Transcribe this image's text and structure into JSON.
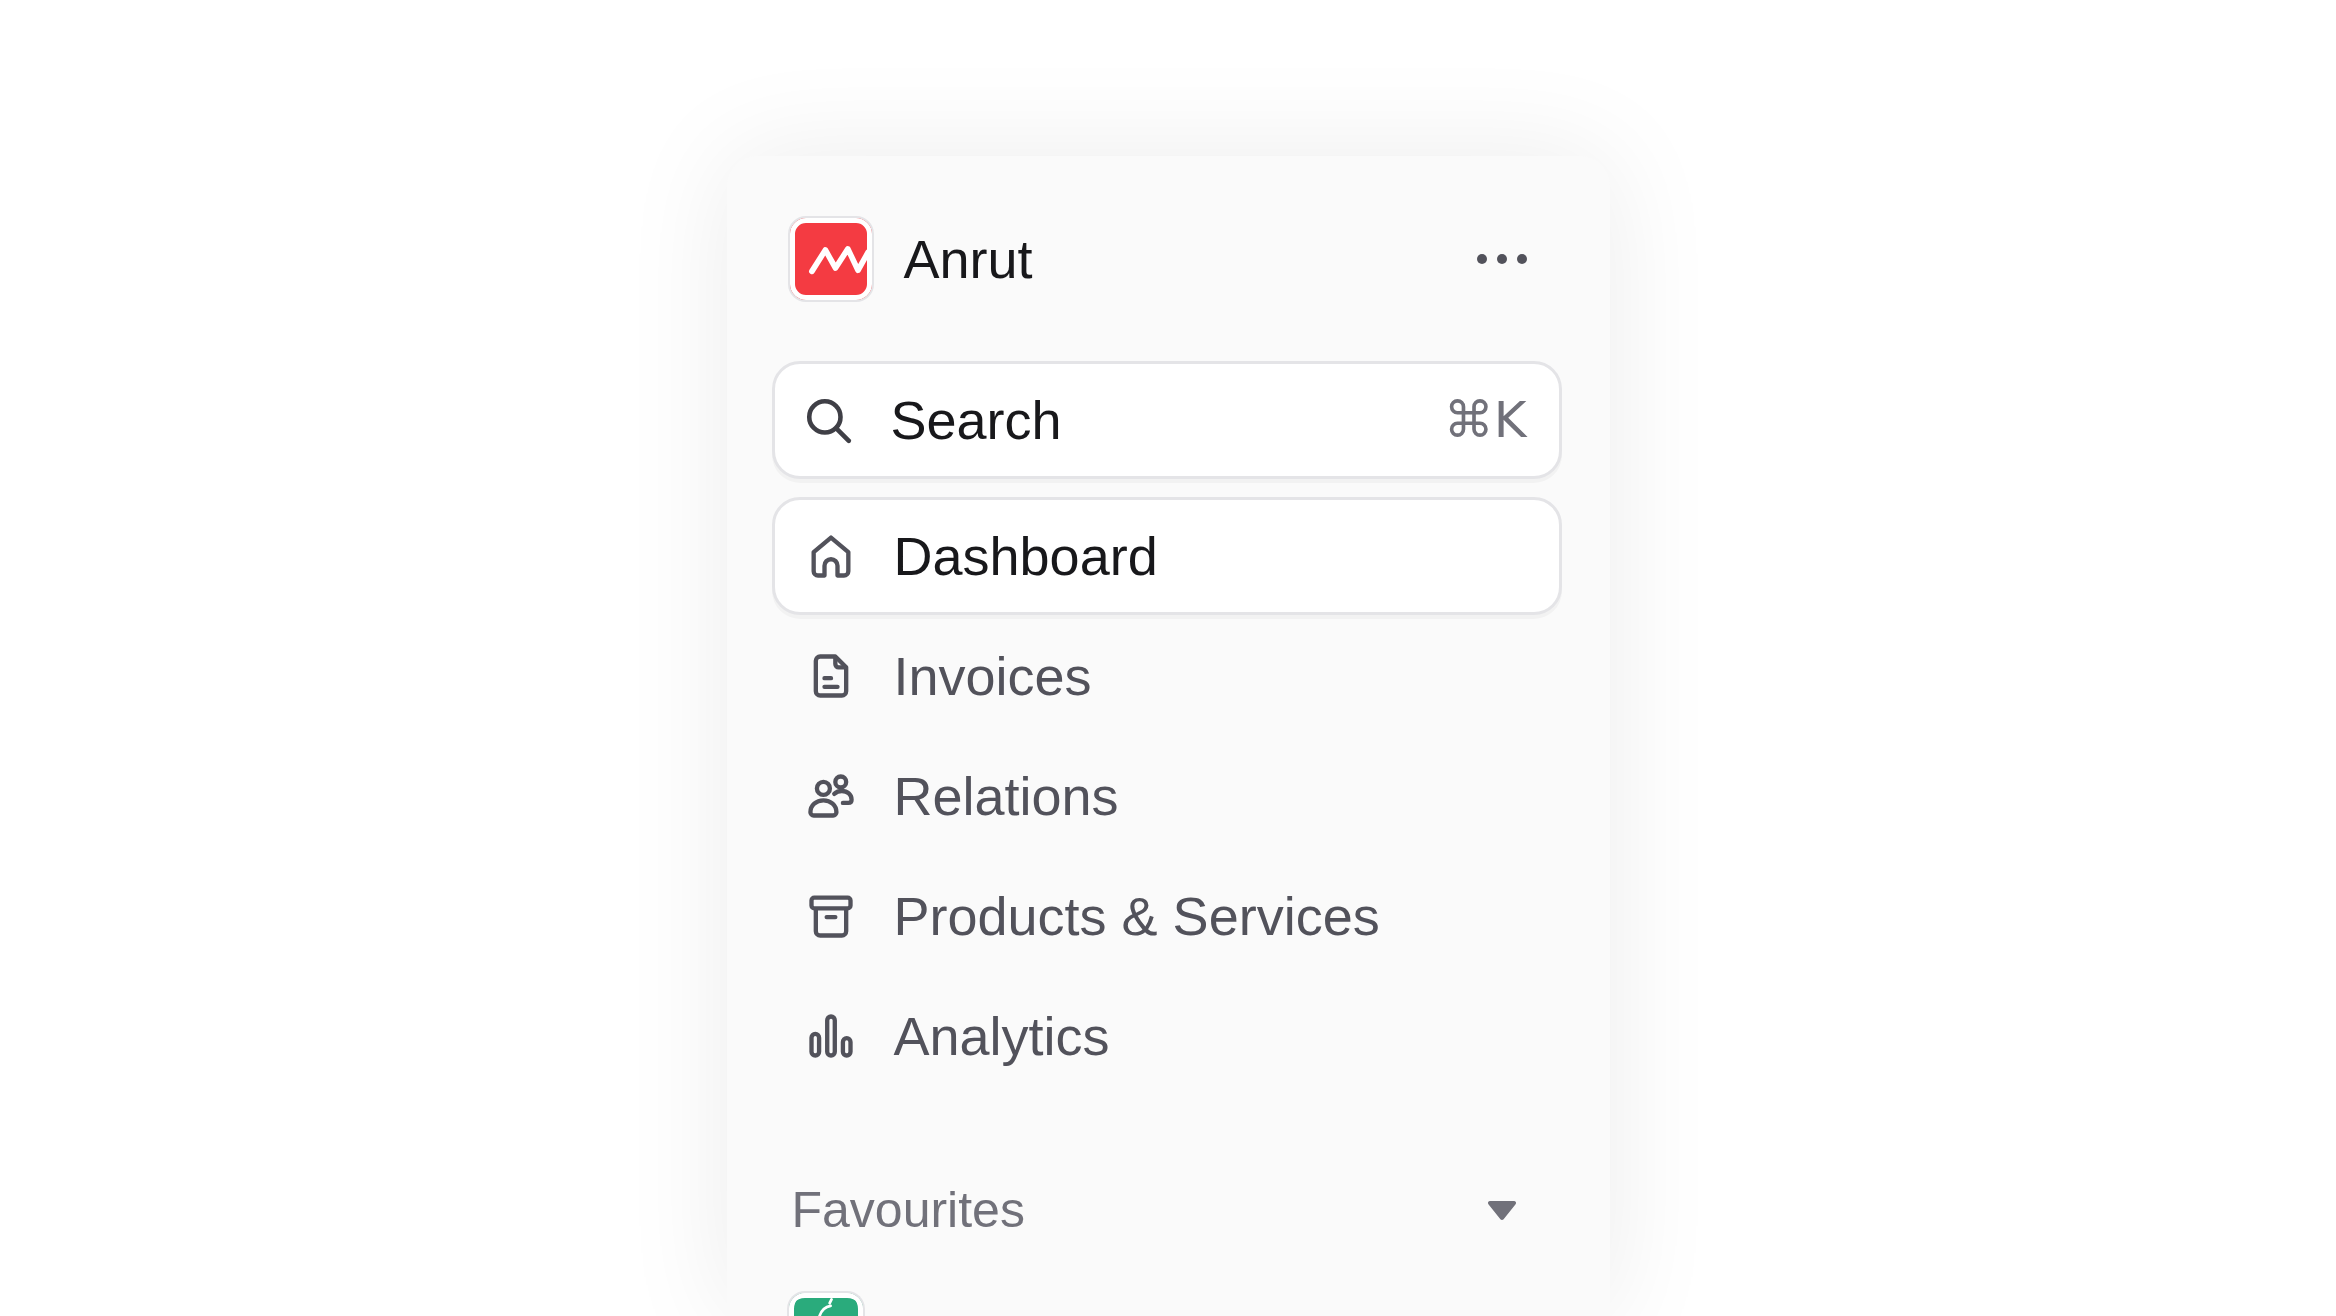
{
  "sidebar": {
    "brand": {
      "name": "Anrut"
    },
    "search": {
      "placeholder": "Search",
      "shortcut": "⌘K"
    },
    "nav": [
      {
        "label": "Dashboard",
        "selected": true
      },
      {
        "label": "Invoices",
        "selected": false
      },
      {
        "label": "Relations",
        "selected": false
      },
      {
        "label": "Products & Services",
        "selected": false
      },
      {
        "label": "Analytics",
        "selected": false
      }
    ],
    "favourites": {
      "label": "Favourites",
      "expanded": true,
      "items": [
        {
          "color": "#2aab7c"
        }
      ]
    }
  }
}
